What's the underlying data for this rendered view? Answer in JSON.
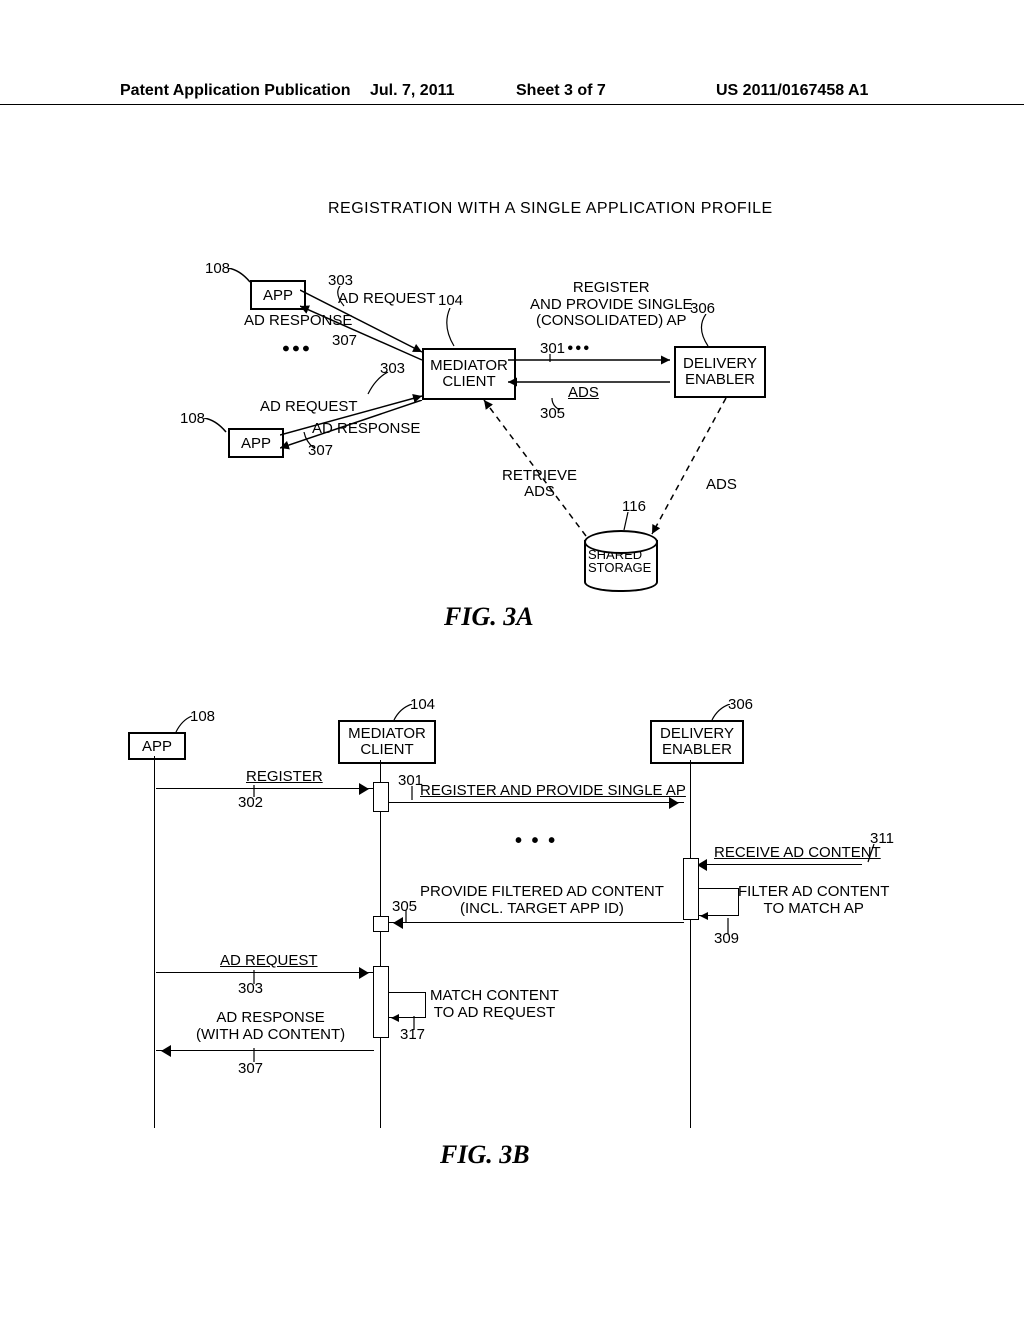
{
  "header": {
    "left": "Patent Application Publication",
    "date": "Jul. 7, 2011",
    "sheet": "Sheet 3 of 7",
    "pubno": "US 2011/0167458 A1"
  },
  "fig3a": {
    "title": "REGISTRATION WITH A SINGLE APPLICATION PROFILE",
    "app": "APP",
    "mediator": "MEDIATOR\nCLIENT",
    "delivery": "DELIVERY\nENABLER",
    "shared": "SHARED\nSTORAGE",
    "ad_request": "AD REQUEST",
    "ad_response": "AD RESPONSE",
    "register": "REGISTER\nAND PROVIDE SINGLE\n(CONSOLIDATED) AP",
    "ads": "ADS",
    "retrieve": "RETRIEVE\nADS",
    "ref_108": "108",
    "ref_303": "303",
    "ref_307": "307",
    "ref_104": "104",
    "ref_301": "301",
    "ref_305": "305",
    "ref_306": "306",
    "ref_116": "116",
    "figlabel": "FIG. 3A"
  },
  "fig3b": {
    "app": "APP",
    "mediator": "MEDIATOR\nCLIENT",
    "delivery": "DELIVERY\nENABLER",
    "register": "REGISTER",
    "register_ap": "REGISTER AND PROVIDE SINGLE AP",
    "receive": "RECEIVE AD CONTENT",
    "filter": "FILTER AD CONTENT\nTO MATCH AP",
    "provide": "PROVIDE FILTERED AD CONTENT\n(INCL. TARGET APP ID)",
    "adreq": "AD REQUEST",
    "match": "MATCH CONTENT\nTO AD REQUEST",
    "adresp": "AD RESPONSE\n(WITH AD CONTENT)",
    "ref_108": "108",
    "ref_104": "104",
    "ref_306": "306",
    "ref_302": "302",
    "ref_301": "301",
    "ref_311": "311",
    "ref_305": "305",
    "ref_309": "309",
    "ref_303": "303",
    "ref_317": "317",
    "ref_307": "307",
    "figlabel": "FIG. 3B"
  }
}
